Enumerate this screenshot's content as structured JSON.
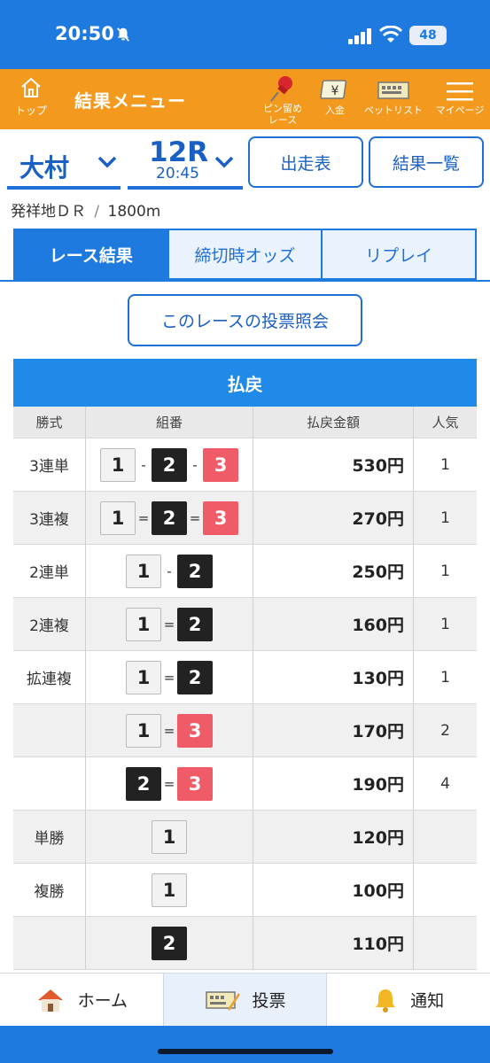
{
  "status_bar": {
    "time": "20:50",
    "battery": "48"
  },
  "header": {
    "home_label": "トップ",
    "title": "結果メニュー",
    "pin_label_1": "ピン留め",
    "pin_label_2": "レース",
    "deposit_label": "入金",
    "deposit_symbol": "¥",
    "betlist_label": "ベットリスト",
    "mypage_label": "マイページ"
  },
  "selector": {
    "place": "大村",
    "race_number": "12R",
    "race_time": "20:45",
    "entries_button": "出走表",
    "results_list_button": "結果一覧"
  },
  "race_meta": {
    "race_name": "発祥地ＤＲ",
    "divider": "/",
    "distance": "1800m"
  },
  "tabs": [
    {
      "label": "レース結果",
      "active": true
    },
    {
      "label": "締切時オッズ",
      "active": false
    },
    {
      "label": "リプレイ",
      "active": false
    }
  ],
  "vote_inquiry_button": "このレースの投票照会",
  "payout": {
    "title": "払戻",
    "headers": {
      "type": "勝式",
      "combo": "組番",
      "amount": "払戻金額",
      "popularity": "人気"
    },
    "rows": [
      {
        "type": "3連単",
        "boats": [
          "1",
          "2",
          "3"
        ],
        "seps": [
          "-",
          "-"
        ],
        "amount": "530円",
        "popularity": "1"
      },
      {
        "type": "3連複",
        "boats": [
          "1",
          "2",
          "3"
        ],
        "seps": [
          "=",
          "="
        ],
        "amount": "270円",
        "popularity": "1"
      },
      {
        "type": "2連単",
        "boats": [
          "1",
          "2"
        ],
        "seps": [
          "-"
        ],
        "amount": "250円",
        "popularity": "1"
      },
      {
        "type": "2連複",
        "boats": [
          "1",
          "2"
        ],
        "seps": [
          "="
        ],
        "amount": "160円",
        "popularity": "1"
      },
      {
        "type": "拡連複",
        "boats": [
          "1",
          "2"
        ],
        "seps": [
          "="
        ],
        "amount": "130円",
        "popularity": "1"
      },
      {
        "type": "",
        "boats": [
          "1",
          "3"
        ],
        "seps": [
          "="
        ],
        "amount": "170円",
        "popularity": "2"
      },
      {
        "type": "",
        "boats": [
          "2",
          "3"
        ],
        "seps": [
          "="
        ],
        "amount": "190円",
        "popularity": "4"
      },
      {
        "type": "単勝",
        "boats": [
          "1"
        ],
        "seps": [],
        "amount": "120円",
        "popularity": ""
      },
      {
        "type": "複勝",
        "boats": [
          "1"
        ],
        "seps": [],
        "amount": "100円",
        "popularity": ""
      },
      {
        "type": "",
        "boats": [
          "2"
        ],
        "seps": [],
        "amount": "110円",
        "popularity": ""
      }
    ]
  },
  "bottom_nav": {
    "home": "ホーム",
    "vote": "投票",
    "notify": "通知"
  },
  "colors": {
    "brand_orange": "#f39a1e",
    "brand_blue": "#1f7ae0",
    "boat1": "#f2f2f2",
    "boat2": "#222222",
    "boat3": "#ef5b66"
  }
}
